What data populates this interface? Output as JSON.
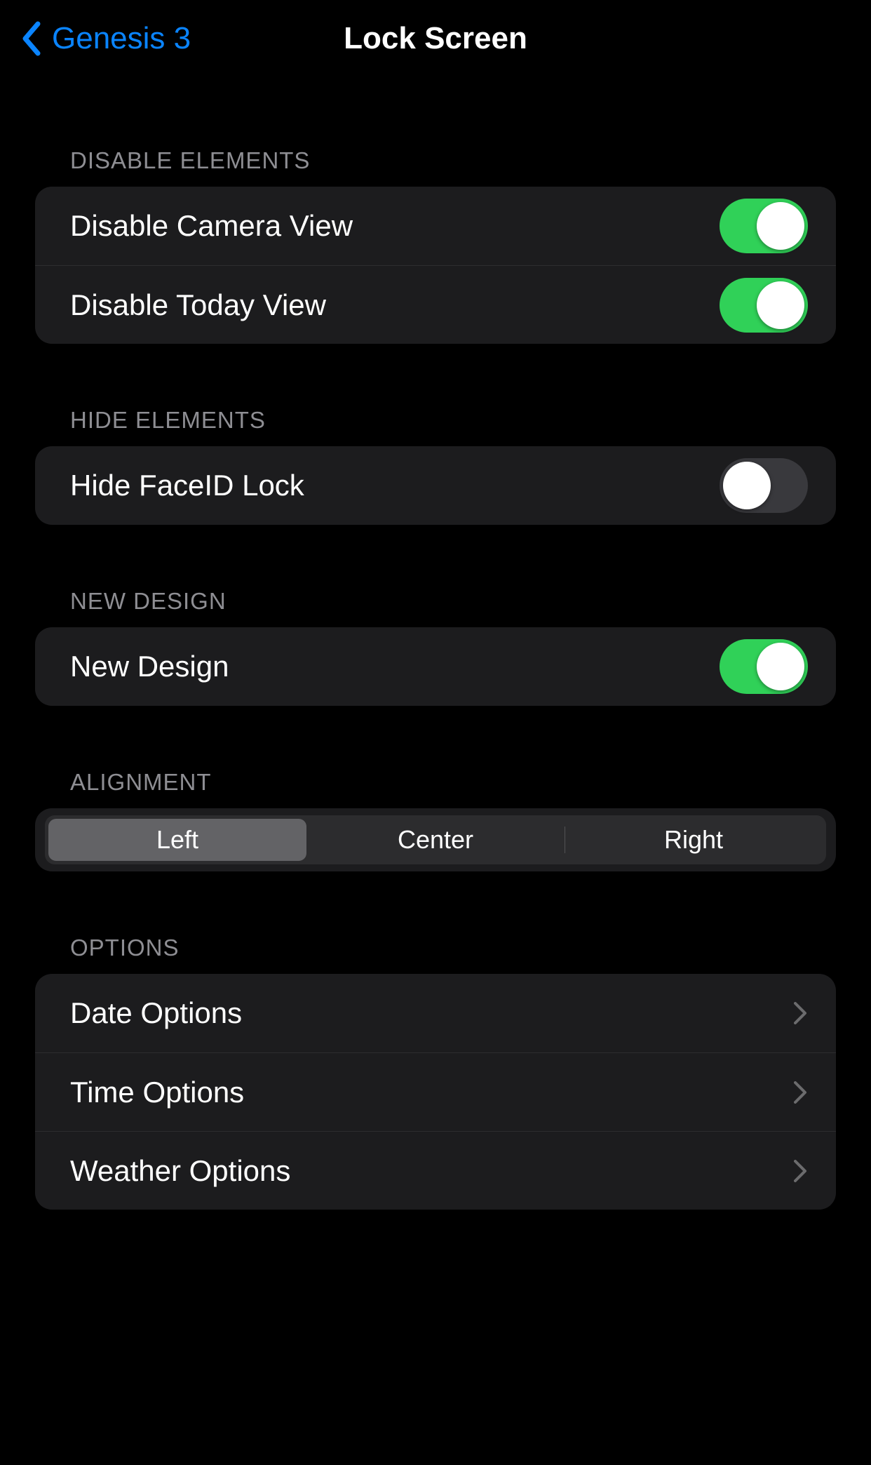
{
  "nav": {
    "back_label": "Genesis 3",
    "title": "Lock Screen"
  },
  "sections": {
    "disable_elements": {
      "header": "Disable Elements",
      "camera": {
        "label": "Disable Camera View",
        "on": true
      },
      "today": {
        "label": "Disable Today View",
        "on": true
      }
    },
    "hide_elements": {
      "header": "Hide Elements",
      "faceid": {
        "label": "Hide FaceID Lock",
        "on": false
      }
    },
    "new_design": {
      "header": "New Design",
      "toggle": {
        "label": "New Design",
        "on": true
      }
    },
    "alignment": {
      "header": "Alignment",
      "options": {
        "left": "Left",
        "center": "Center",
        "right": "Right"
      },
      "selected": "left"
    },
    "options": {
      "header": "Options",
      "date": {
        "label": "Date Options"
      },
      "time": {
        "label": "Time Options"
      },
      "weather": {
        "label": "Weather Options"
      }
    }
  },
  "colors": {
    "accent": "#0a84ff",
    "switch_on": "#30d158",
    "group_bg": "#1c1c1e"
  }
}
